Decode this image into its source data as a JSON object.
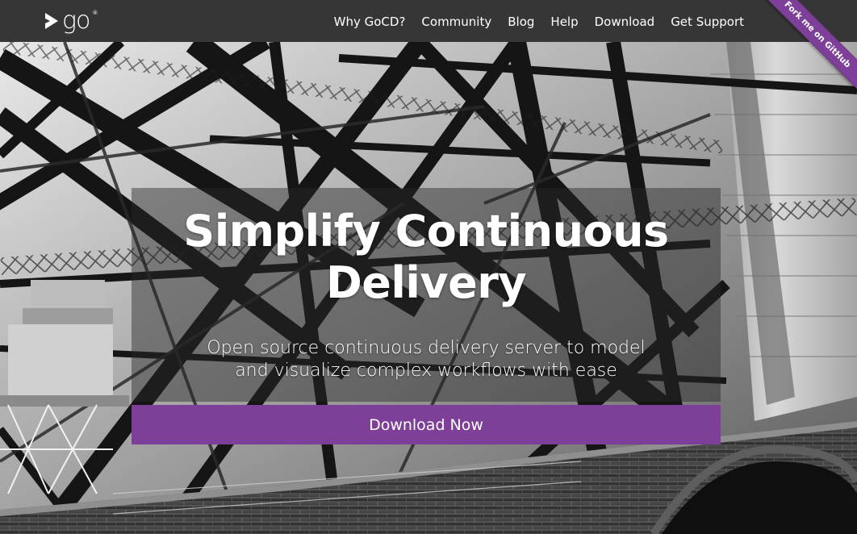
{
  "navbar": {
    "logo_text": "go",
    "logo_mark": "®",
    "items": [
      {
        "label": "Why GoCD?"
      },
      {
        "label": "Community"
      },
      {
        "label": "Blog"
      },
      {
        "label": "Help"
      },
      {
        "label": "Download"
      },
      {
        "label": "Get Support"
      }
    ]
  },
  "ribbon": {
    "label": "Fork me on GitHub",
    "color": "#7d3f98"
  },
  "hero": {
    "title_line1": "Simplify Continuous",
    "title_line2": "Delivery",
    "subtitle_line1": "Open source continuous delivery server to model",
    "subtitle_line2": "and visualize complex workflows with ease",
    "cta_label": "Download Now",
    "background": "black-and-white photo of steel bridge girders and brick tower"
  },
  "colors": {
    "accent": "#7d3f98",
    "navbar_bg": "#363636",
    "text": "#ffffff"
  },
  "icons": {
    "logo": "gocd-arrow-logo-icon"
  }
}
